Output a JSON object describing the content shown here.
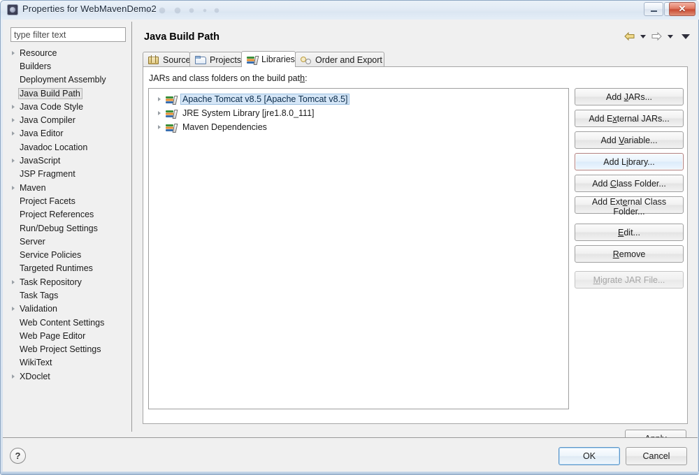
{
  "window": {
    "title": "Properties for WebMavenDemo2",
    "app_icon": "eclipse-icon",
    "controls": {
      "minimize": "minimize-icon",
      "maximize": "maximize-icon",
      "close": "✕"
    }
  },
  "sidebar": {
    "filter": {
      "placeholder": "type filter text",
      "value": ""
    },
    "items": [
      {
        "label": "Resource",
        "expandable": true,
        "selected": false
      },
      {
        "label": "Builders",
        "expandable": false,
        "selected": false
      },
      {
        "label": "Deployment Assembly",
        "expandable": false,
        "selected": false
      },
      {
        "label": "Java Build Path",
        "expandable": false,
        "selected": true
      },
      {
        "label": "Java Code Style",
        "expandable": true,
        "selected": false
      },
      {
        "label": "Java Compiler",
        "expandable": true,
        "selected": false
      },
      {
        "label": "Java Editor",
        "expandable": true,
        "selected": false
      },
      {
        "label": "Javadoc Location",
        "expandable": false,
        "selected": false
      },
      {
        "label": "JavaScript",
        "expandable": true,
        "selected": false
      },
      {
        "label": "JSP Fragment",
        "expandable": false,
        "selected": false
      },
      {
        "label": "Maven",
        "expandable": true,
        "selected": false
      },
      {
        "label": "Project Facets",
        "expandable": false,
        "selected": false
      },
      {
        "label": "Project References",
        "expandable": false,
        "selected": false
      },
      {
        "label": "Run/Debug Settings",
        "expandable": false,
        "selected": false
      },
      {
        "label": "Server",
        "expandable": false,
        "selected": false
      },
      {
        "label": "Service Policies",
        "expandable": false,
        "selected": false
      },
      {
        "label": "Targeted Runtimes",
        "expandable": false,
        "selected": false
      },
      {
        "label": "Task Repository",
        "expandable": true,
        "selected": false
      },
      {
        "label": "Task Tags",
        "expandable": false,
        "selected": false
      },
      {
        "label": "Validation",
        "expandable": true,
        "selected": false
      },
      {
        "label": "Web Content Settings",
        "expandable": false,
        "selected": false
      },
      {
        "label": "Web Page Editor",
        "expandable": false,
        "selected": false
      },
      {
        "label": "Web Project Settings",
        "expandable": false,
        "selected": false
      },
      {
        "label": "WikiText",
        "expandable": false,
        "selected": false
      },
      {
        "label": "XDoclet",
        "expandable": true,
        "selected": false
      }
    ]
  },
  "page": {
    "title": "Java Build Path",
    "nav": {
      "back_icon": "back-arrow-icon",
      "back_menu_icon": "chevron-down-icon",
      "forward_icon": "forward-arrow-icon",
      "forward_menu_icon": "chevron-down-icon",
      "view_menu_icon": "chevron-down-icon"
    }
  },
  "tabs": [
    {
      "label": "Source",
      "icon": "source-package-icon",
      "active": false
    },
    {
      "label": "Projects",
      "icon": "folder-icon",
      "active": false
    },
    {
      "label": "Libraries",
      "icon": "library-books-icon",
      "active": true
    },
    {
      "label": "Order and Export",
      "icon": "order-export-icon",
      "active": false
    }
  ],
  "libraries_tab": {
    "description": "JARs and class folders on the build path:",
    "entries": [
      {
        "label": "Apache Tomcat v8.5 [Apache Tomcat v8.5]",
        "icon": "library-books-icon",
        "expandable": true,
        "selected": true
      },
      {
        "label": "JRE System Library [jre1.8.0_111]",
        "icon": "library-books-icon",
        "expandable": true,
        "selected": false
      },
      {
        "label": "Maven Dependencies",
        "icon": "library-books-icon",
        "expandable": true,
        "selected": false
      }
    ],
    "buttons": [
      {
        "label": "Add JARs...",
        "mnemonic": "J",
        "state": "normal"
      },
      {
        "label": "Add External JARs...",
        "mnemonic": "x",
        "state": "normal"
      },
      {
        "label": "Add Variable...",
        "mnemonic": "V",
        "state": "normal"
      },
      {
        "label": "Add Library...",
        "mnemonic": "i",
        "state": "focused"
      },
      {
        "label": "Add Class Folder...",
        "mnemonic": "C",
        "state": "normal"
      },
      {
        "label": "Add External Class Folder...",
        "mnemonic": "e",
        "state": "normal"
      },
      {
        "label": "Edit...",
        "mnemonic": "E",
        "state": "normal"
      },
      {
        "label": "Remove",
        "mnemonic": "R",
        "state": "normal"
      },
      {
        "label": "Migrate JAR File...",
        "mnemonic": "M",
        "state": "disabled"
      }
    ]
  },
  "footer": {
    "help_icon": "?",
    "apply_label": "Apply",
    "ok_label": "OK",
    "cancel_label": "Cancel"
  },
  "colors": {
    "selection_blue": "#d5e6f7",
    "selection_border": "#9cc0e0",
    "focus_red": "#b08080",
    "default_button_blue": "#5a94c8",
    "close_red": "#c84b33"
  }
}
